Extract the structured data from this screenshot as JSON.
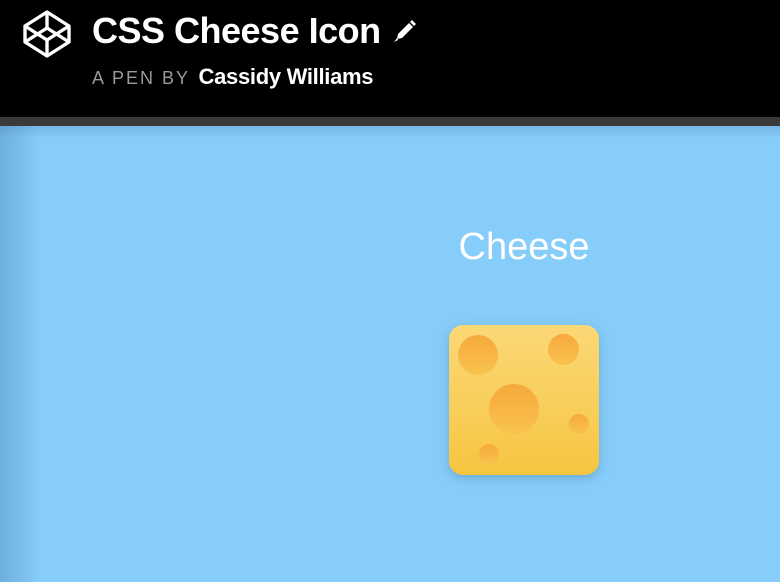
{
  "header": {
    "title": "CSS Cheese Icon",
    "byline_prefix": "A PEN BY",
    "author": "Cassidy Williams",
    "logo_icon": "codepen-logo-icon",
    "edit_icon": "pencil-icon"
  },
  "stage": {
    "background_color": "#87cdf9",
    "label": "Cheese",
    "icon": "cheese-icon"
  },
  "colors": {
    "header_background": "#000000",
    "divider": "#3a3a3a",
    "cheese_yellow": "#f8cd58",
    "hole_orange": "#f6a93c"
  }
}
